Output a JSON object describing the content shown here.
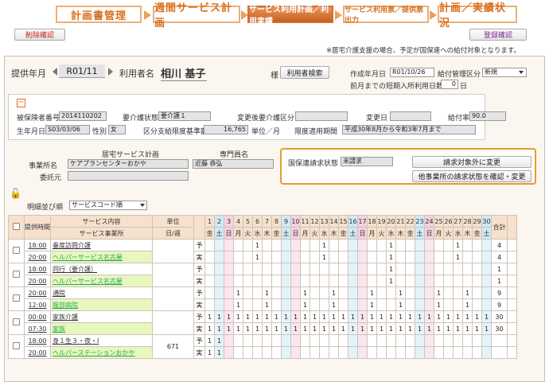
{
  "nav": {
    "tabs": [
      "計画書管理",
      "週間サービス計画",
      "サービス利用計画／利用実績",
      "サービス利用票／提供票出力",
      "計画／実績状況"
    ]
  },
  "buttons": {
    "delete": "削除確認",
    "register": "登録確認",
    "user_search": "利用者検索",
    "exclude": "請求対象外に変更",
    "check_other": "他事業所の請求状態を確認・変更"
  },
  "note": "※居宅介護支援の場合、予定が国保連への給付対象となります。",
  "header": {
    "year_label": "提供年月",
    "year_value": "R01/11",
    "user_label": "利用者名",
    "user_name": "相川 基子",
    "sama": "様",
    "created_label": "作成年月日",
    "created_value": "R01/10/26",
    "benefit_label": "給付管理区分",
    "benefit_value": "新規",
    "short_stay_label": "前月までの短期入所利用日数",
    "short_stay_value": "0",
    "short_stay_unit": "日"
  },
  "info": {
    "insured_no_label": "被保険者番号",
    "insured_no": "2014110202",
    "care_level_label": "要介護状態",
    "care_level": "要介護１",
    "changed_level_label": "変更後要介護区分",
    "changed_level": "",
    "change_date_label": "変更日",
    "change_date": "",
    "rate_label": "給付率",
    "rate": "90.0",
    "birth_label": "生年月日",
    "birth": "S03/03/06",
    "sex_label": "性別",
    "sex": "女",
    "limit_label": "区分支給限度基準額",
    "limit": "16,765",
    "limit_unit": "単位／月",
    "period_label": "限度適用期間",
    "period": "平成30年8月から令和3年7月まで"
  },
  "office": {
    "plan_header": "居宅サービス計画",
    "staff_header": "専門員名",
    "office_label": "事業所名",
    "office_name": "ケアプランセンターおかや",
    "staff_name": "近藤 恭弘",
    "consign_label": "委託元",
    "consign": ""
  },
  "claim": {
    "status_label": "国保連請求状態",
    "status_value": "未請求"
  },
  "sort": {
    "label": "明細並び順",
    "value": "サービスコード順"
  },
  "grid": {
    "h_time": "提供時間",
    "h_time2": "",
    "h_service": "サービス内容",
    "h_office": "サービス事業所",
    "h_unit": "単位",
    "h_perweek": "日/週",
    "h_total": "合計",
    "days": [
      "1",
      "2",
      "3",
      "4",
      "5",
      "6",
      "7",
      "8",
      "9",
      "10",
      "11",
      "12",
      "13",
      "14",
      "15",
      "16",
      "17",
      "18",
      "19",
      "20",
      "21",
      "22",
      "23",
      "24",
      "25",
      "26",
      "27",
      "28",
      "29",
      "30"
    ],
    "weekdays": [
      "金",
      "土",
      "日",
      "月",
      "火",
      "水",
      "木",
      "金",
      "土",
      "日",
      "月",
      "火",
      "水",
      "木",
      "金",
      "土",
      "日",
      "月",
      "火",
      "水",
      "木",
      "金",
      "土",
      "日",
      "月",
      "火",
      "水",
      "木",
      "金",
      "土"
    ],
    "plan_mark": "予",
    "act_mark": "実",
    "rows": [
      {
        "t1": "18:00",
        "t2": "20:00",
        "svc": "垂度訪問介護",
        "office": "ヘルパーサービス名古屋",
        "unit": "",
        "plan": [
          0,
          0,
          0,
          0,
          0,
          1,
          0,
          0,
          0,
          0,
          0,
          0,
          1,
          0,
          0,
          0,
          0,
          0,
          0,
          1,
          0,
          0,
          0,
          0,
          0,
          0,
          1,
          0,
          0,
          0
        ],
        "act": [
          0,
          0,
          0,
          0,
          0,
          1,
          0,
          0,
          0,
          0,
          0,
          0,
          1,
          0,
          0,
          0,
          0,
          0,
          0,
          1,
          0,
          0,
          0,
          0,
          0,
          0,
          1,
          0,
          0,
          0
        ],
        "ptotal": "4",
        "atotal": "4"
      },
      {
        "t1": "18:00",
        "t2": "20:00",
        "svc": "同行（要介護）",
        "office": "ヘルパーサービス名古屋",
        "unit": "",
        "plan": [
          0,
          0,
          0,
          0,
          0,
          0,
          0,
          0,
          0,
          0,
          0,
          0,
          0,
          0,
          0,
          0,
          0,
          0,
          0,
          1,
          0,
          0,
          0,
          0,
          0,
          0,
          0,
          0,
          0,
          0
        ],
        "act": [
          0,
          0,
          0,
          0,
          0,
          0,
          0,
          0,
          0,
          0,
          0,
          0,
          0,
          0,
          0,
          0,
          0,
          0,
          0,
          1,
          0,
          0,
          0,
          0,
          0,
          0,
          0,
          0,
          0,
          0
        ],
        "ptotal": "1",
        "atotal": "1"
      },
      {
        "t1": "20:00",
        "t2": "12:00",
        "svc": "通院",
        "office": "服部病院",
        "unit": "",
        "plan": [
          0,
          0,
          0,
          1,
          0,
          0,
          1,
          0,
          0,
          0,
          1,
          0,
          0,
          1,
          0,
          0,
          0,
          1,
          0,
          0,
          1,
          0,
          0,
          0,
          1,
          0,
          0,
          1,
          0,
          0
        ],
        "act": [
          0,
          0,
          0,
          1,
          0,
          0,
          1,
          0,
          0,
          0,
          1,
          0,
          0,
          1,
          0,
          0,
          0,
          1,
          0,
          0,
          1,
          0,
          0,
          0,
          1,
          0,
          0,
          1,
          0,
          0
        ],
        "ptotal": "9",
        "atotal": "9"
      },
      {
        "t1": "00:00",
        "t2": "07:30",
        "svc": "家族介護",
        "office": "家族",
        "unit": "",
        "plan": [
          1,
          1,
          1,
          1,
          1,
          1,
          1,
          1,
          1,
          1,
          1,
          1,
          1,
          1,
          1,
          1,
          1,
          1,
          1,
          1,
          1,
          1,
          1,
          1,
          1,
          1,
          1,
          1,
          1,
          1
        ],
        "act": [
          1,
          1,
          1,
          1,
          1,
          1,
          1,
          1,
          1,
          1,
          1,
          1,
          1,
          1,
          1,
          1,
          1,
          1,
          1,
          1,
          1,
          1,
          1,
          1,
          1,
          1,
          1,
          1,
          1,
          1
        ],
        "ptotal": "30",
        "atotal": "30"
      },
      {
        "t1": "18:00",
        "t2": "20:00",
        "svc": "身１生３・夜・Ⅰ",
        "office": "ヘルパーステーションおかや",
        "unit": "671",
        "plan": [
          1,
          1,
          0,
          0,
          0,
          0,
          0,
          0,
          0,
          0,
          0,
          0,
          0,
          0,
          0,
          0,
          0,
          0,
          0,
          0,
          0,
          0,
          0,
          0,
          0,
          0,
          0,
          0,
          0,
          0
        ],
        "act": [
          1,
          1,
          0,
          0,
          0,
          0,
          0,
          0,
          0,
          0,
          0,
          0,
          0,
          0,
          0,
          0,
          0,
          0,
          0,
          0,
          0,
          0,
          0,
          0,
          0,
          0,
          0,
          0,
          0,
          0
        ],
        "ptotal": "",
        "atotal": ""
      }
    ]
  }
}
